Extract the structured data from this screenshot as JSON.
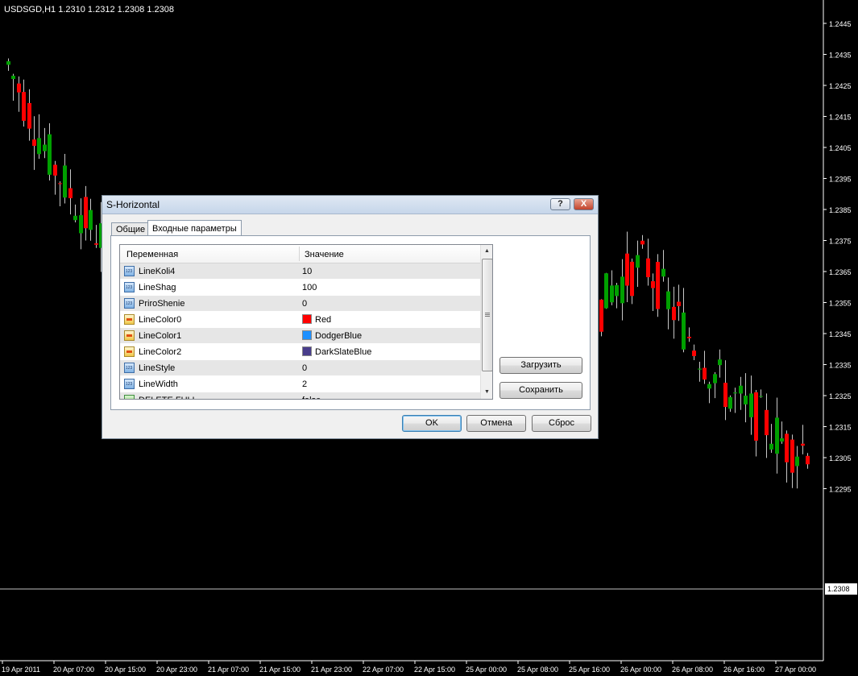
{
  "chart": {
    "info": "USDSGD,H1  1.2310 1.2312 1.2308 1.2308",
    "current_price": "1.2308",
    "price_labels": [
      "1.2445",
      "1.2435",
      "1.2425",
      "1.2415",
      "1.2405",
      "1.2395",
      "1.2385",
      "1.2375",
      "1.2365",
      "1.2355",
      "1.2345",
      "1.2335",
      "1.2325",
      "1.2315",
      "1.2305",
      "1.2295"
    ],
    "time_labels": [
      "19 Apr 2011",
      "20 Apr 07:00",
      "20 Apr 15:00",
      "20 Apr 23:00",
      "21 Apr 07:00",
      "21 Apr 15:00",
      "21 Apr 23:00",
      "22 Apr 07:00",
      "22 Apr 15:00",
      "25 Apr 00:00",
      "25 Apr 08:00",
      "25 Apr 16:00",
      "26 Apr 00:00",
      "26 Apr 08:00",
      "26 Apr 16:00",
      "27 Apr 00:00"
    ],
    "colors": {
      "background": "#000000",
      "axis": "#ffffff",
      "bull": "#00a000",
      "bear": "#ff0000",
      "wick": "#c8c8c8"
    }
  },
  "dialog": {
    "title": "S-Horizontal",
    "help_glyph": "?",
    "close_glyph": "X",
    "tabs": [
      "Общие",
      "Входные параметры"
    ],
    "active_tab": 1,
    "columns": [
      "Переменная",
      "Значение"
    ],
    "rows": [
      {
        "name": "LineKoli4",
        "value": "10",
        "icon": "int-icon"
      },
      {
        "name": "LineShag",
        "value": "100",
        "icon": "int-icon"
      },
      {
        "name": "PriroShenie",
        "value": "0",
        "icon": "int-icon"
      },
      {
        "name": "LineColor0",
        "value": "Red",
        "icon": "color-icon",
        "swatch": "#ff0000"
      },
      {
        "name": "LineColor1",
        "value": "DodgerBlue",
        "icon": "color-icon",
        "swatch": "#1e90ff"
      },
      {
        "name": "LineColor2",
        "value": "DarkSlateBlue",
        "icon": "color-icon",
        "swatch": "#483d8b"
      },
      {
        "name": "LineStyle",
        "value": "0",
        "icon": "int-icon"
      },
      {
        "name": "LineWidth",
        "value": "2",
        "icon": "int-icon"
      },
      {
        "name": "DELETE FULL",
        "value": "false",
        "icon": "bool-icon"
      }
    ],
    "buttons": {
      "load": "Загрузить",
      "save": "Сохранить",
      "ok": "OK",
      "cancel": "Отмена",
      "reset": "Сброс"
    }
  }
}
